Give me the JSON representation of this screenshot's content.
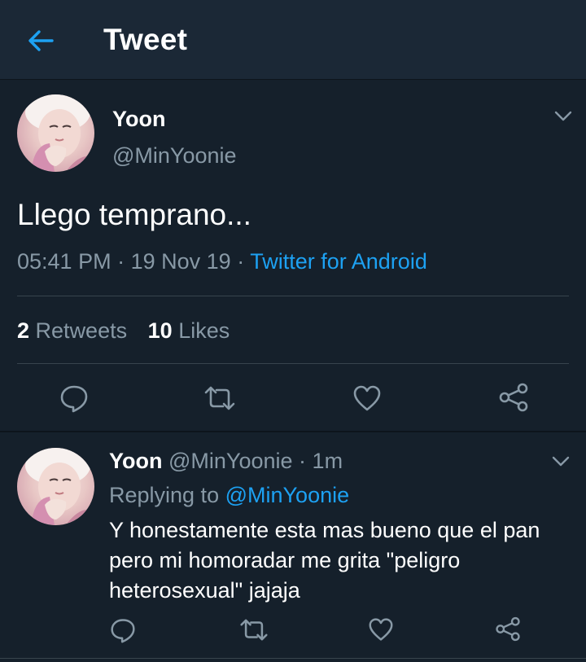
{
  "header": {
    "title": "Tweet",
    "back_icon": "arrow-left-icon",
    "accent": "#1da1f2"
  },
  "tweet": {
    "author_name": "Yoon",
    "author_handle": "@MinYoonie",
    "text": "Llego temprano...",
    "time": "05:41 PM",
    "separator": "·",
    "date": "19 Nov 19",
    "source": "Twitter for Android",
    "retweets_count": "2",
    "retweets_label": "Retweets",
    "likes_count": "10",
    "likes_label": "Likes",
    "actions": [
      "reply-icon",
      "retweet-icon",
      "like-icon",
      "share-icon"
    ]
  },
  "reply": {
    "author_name": "Yoon",
    "author_handle": "@MinYoonie",
    "separator": "·",
    "time_ago": "1m",
    "replying_to_label": "Replying to",
    "replying_to_handle": "@MinYoonie",
    "text": "Y honestamente esta mas bueno que el pan pero mi homoradar me grita \"peligro heterosexual\" jajaja",
    "actions": [
      "reply-icon",
      "retweet-icon",
      "like-icon",
      "share-icon"
    ]
  },
  "colors": {
    "background": "#15202b",
    "header_bg": "#1b2836",
    "secondary_text": "#8899a6",
    "divider": "#38444d"
  }
}
